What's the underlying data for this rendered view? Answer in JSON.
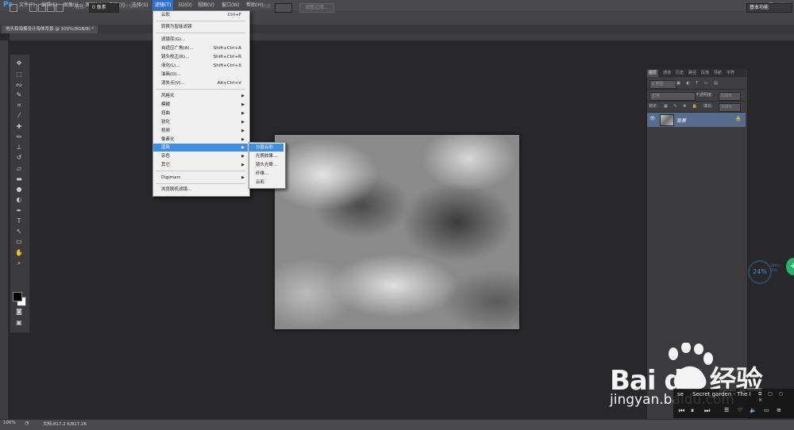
{
  "app": {
    "logo": "Ps"
  },
  "menubar": {
    "items": [
      "文件(F)",
      "编辑(E)",
      "图像(I)",
      "图层(L)",
      "文字(Y)",
      "选择(S)",
      "滤镜(T)",
      "3D(D)",
      "视图(V)",
      "窗口(W)",
      "帮助(H)"
    ],
    "window_buttons": [
      "–",
      "□",
      "✕"
    ]
  },
  "options": {
    "feather_label": "羽化:",
    "feather_value": "0 像素",
    "antialias": "消除锯齿",
    "height_label": "高度:",
    "refine_button": "调整边缘...",
    "workspace": "基本功能"
  },
  "document": {
    "tab_title": "地头和海报设计海体背景 @ 100%(RGB/8) *"
  },
  "filter_menu": {
    "items": [
      {
        "label": "云彩",
        "shortcut": "Ctrl+F"
      },
      {
        "label": "转换为智能滤镜",
        "shortcut": ""
      },
      {
        "label": "滤镜库(G)...",
        "shortcut": ""
      },
      {
        "label": "自适应广角(A)...",
        "shortcut": "Shift+Ctrl+A"
      },
      {
        "label": "镜头校正(R)...",
        "shortcut": "Shift+Ctrl+R"
      },
      {
        "label": "液化(L)...",
        "shortcut": "Shift+Ctrl+X"
      },
      {
        "label": "油画(O)...",
        "shortcut": ""
      },
      {
        "label": "消失点(V)...",
        "shortcut": "Alt+Ctrl+V"
      },
      {
        "label": "风格化",
        "shortcut": ""
      },
      {
        "label": "模糊",
        "shortcut": ""
      },
      {
        "label": "扭曲",
        "shortcut": ""
      },
      {
        "label": "锐化",
        "shortcut": ""
      },
      {
        "label": "视频",
        "shortcut": ""
      },
      {
        "label": "像素化",
        "shortcut": ""
      },
      {
        "label": "渲染",
        "shortcut": ""
      },
      {
        "label": "杂色",
        "shortcut": ""
      },
      {
        "label": "其它",
        "shortcut": ""
      },
      {
        "label": "Digimarc",
        "shortcut": ""
      },
      {
        "label": "浏览联机滤镜...",
        "shortcut": ""
      }
    ]
  },
  "render_menu": {
    "items": [
      "分层云彩",
      "光照效果...",
      "镜头光晕...",
      "纤维...",
      "云彩"
    ]
  },
  "layers_panel": {
    "tabs": [
      "图层",
      "通道",
      "历史",
      "路径",
      "段落",
      "导航",
      "字符"
    ],
    "kind_label": "ρ 类型",
    "blend_mode": "正常",
    "opacity_label": "不透明度:",
    "opacity_value": "100%",
    "lock_label": "锁定:",
    "fill_label": "填充:",
    "fill_value": "100%",
    "layer_name": "背景"
  },
  "meter": {
    "value": "24%",
    "label_top": "38K/s",
    "label_bottom": "CPU"
  },
  "music": {
    "title": "Secret garden - The I",
    "prefix": "se"
  },
  "status": {
    "zoom": "100%",
    "doc_size": "文档:817.2 K/817.2K"
  },
  "watermark": {
    "brand": "Bai du 经验",
    "url": "jingyan.baidu.com"
  }
}
